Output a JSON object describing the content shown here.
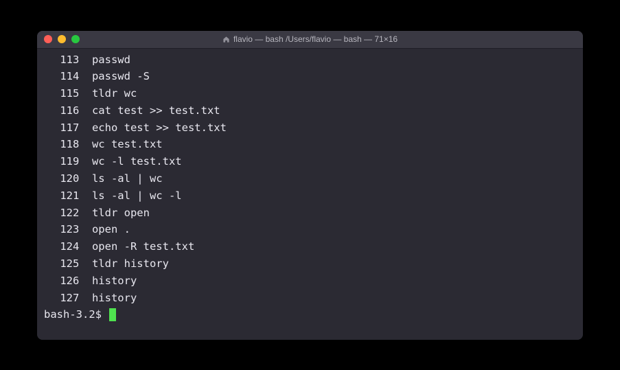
{
  "window": {
    "title": "flavio — bash /Users/flavio — bash — 71×16"
  },
  "history": [
    {
      "num": "113",
      "cmd": "passwd"
    },
    {
      "num": "114",
      "cmd": "passwd -S"
    },
    {
      "num": "115",
      "cmd": "tldr wc"
    },
    {
      "num": "116",
      "cmd": "cat test >> test.txt"
    },
    {
      "num": "117",
      "cmd": "echo test >> test.txt"
    },
    {
      "num": "118",
      "cmd": "wc test.txt"
    },
    {
      "num": "119",
      "cmd": "wc -l test.txt"
    },
    {
      "num": "120",
      "cmd": "ls -al | wc"
    },
    {
      "num": "121",
      "cmd": "ls -al | wc -l"
    },
    {
      "num": "122",
      "cmd": "tldr open"
    },
    {
      "num": "123",
      "cmd": "open ."
    },
    {
      "num": "124",
      "cmd": "open -R test.txt"
    },
    {
      "num": "125",
      "cmd": "tldr history"
    },
    {
      "num": "126",
      "cmd": "history"
    },
    {
      "num": "127",
      "cmd": "history"
    }
  ],
  "prompt": "bash-3.2$ "
}
